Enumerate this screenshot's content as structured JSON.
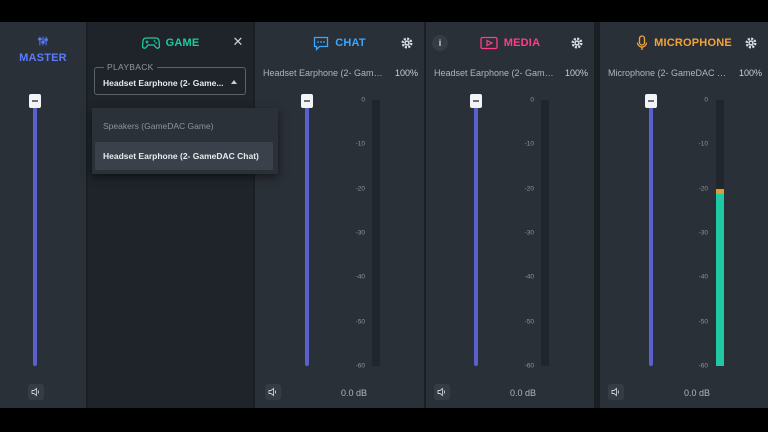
{
  "colors": {
    "master": "#5b7bff",
    "game": "#1fc9a3",
    "chat": "#3aa7ff",
    "media": "#ff3d8b",
    "microphone": "#f2a43a",
    "slider_track": "#5b5fd0",
    "meter_level": "#1fc9a3",
    "meter_peak": "#e39a2c"
  },
  "master": {
    "label": "MASTER",
    "icon": "sliders-icon",
    "volume_level_percent": 100
  },
  "game": {
    "label": "GAME",
    "icon": "gamepad-icon",
    "close_icon": "close-icon",
    "playback_label": "PLAYBACK",
    "selected_device": "Headset Earphone (2- Game...",
    "dropdown_options": [
      "Speakers (GameDAC Game)",
      "Headset Earphone (2- GameDAC Chat)"
    ]
  },
  "chat": {
    "label": "CHAT",
    "icon": "chat-icon",
    "device": "Headset Earphone (2- Game...",
    "volume": "100%",
    "db": "0.0 dB",
    "volume_level_percent": 100
  },
  "media": {
    "label": "MEDIA",
    "icon": "media-player-icon",
    "info_label": "i",
    "device": "Headset Earphone (2- Game...",
    "volume": "100%",
    "db": "0.0 dB",
    "volume_level_percent": 100
  },
  "microphone": {
    "label": "MICROPHONE",
    "icon": "microphone-icon",
    "device": "Microphone (2- GameDAC C...",
    "volume": "100%",
    "db": "0.0 dB",
    "volume_level_percent": 100,
    "meter_level_db": -20
  },
  "scale_ticks": [
    "0",
    "-10",
    "-20",
    "-30",
    "-40",
    "-50",
    "-60"
  ]
}
